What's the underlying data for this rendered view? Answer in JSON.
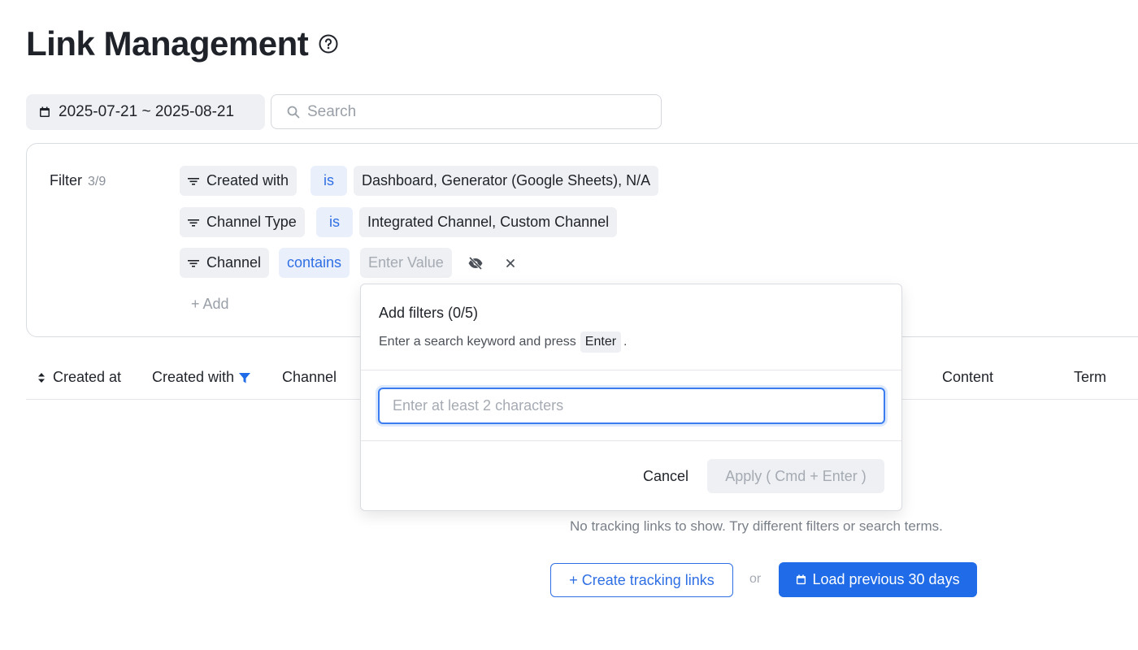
{
  "header": {
    "title": "Link Management",
    "help_icon": "help-circle-icon"
  },
  "toolbar": {
    "date_range": "2025-07-21 ~ 2025-08-21",
    "search_placeholder": "Search"
  },
  "filter": {
    "label": "Filter",
    "count": "3/9",
    "rows": [
      {
        "field": "Created with",
        "operator": "is",
        "value": "Dashboard, Generator (Google Sheets), N/A"
      },
      {
        "field": "Channel Type",
        "operator": "is",
        "value": "Integrated Channel, Custom Channel"
      },
      {
        "field": "Channel",
        "operator": "contains",
        "value_placeholder": "Enter Value"
      }
    ],
    "add_label": "+ Add"
  },
  "table": {
    "columns": [
      "Created at",
      "Created with",
      "Channel",
      "Content",
      "Term"
    ]
  },
  "empty": {
    "message": "No tracking links to show. Try different filters or search terms.",
    "create_label": "+  Create tracking links",
    "or_label": "or",
    "load_label": "Load previous 30 days"
  },
  "dropdown": {
    "title": "Add filters (0/5)",
    "hint_prefix": "Enter a search keyword and press",
    "hint_key": "Enter",
    "hint_suffix": ".",
    "input_placeholder": "Enter at least 2 characters",
    "cancel_label": "Cancel",
    "apply_label": "Apply ( Cmd +  Enter )"
  },
  "colors": {
    "primary": "#1f6be8",
    "chip_bg": "#eef0f3",
    "operator_text": "#2f6fe4"
  }
}
